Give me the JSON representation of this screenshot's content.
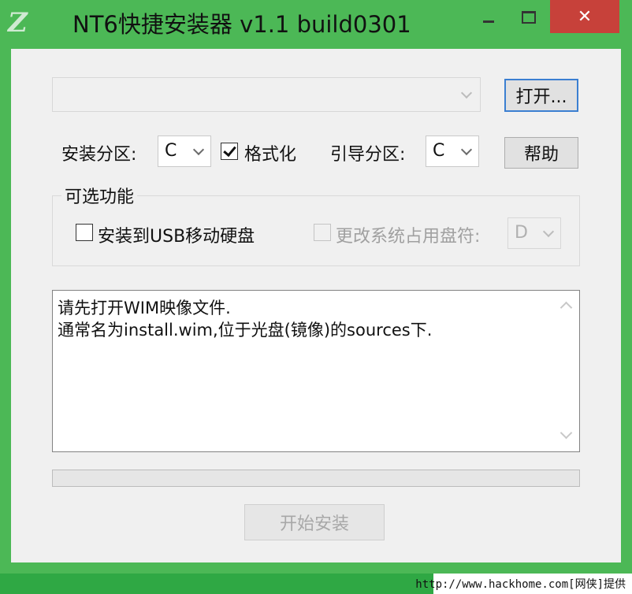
{
  "window": {
    "title": "NT6快捷安装器 v1.1 build0301",
    "close_label": "✕"
  },
  "wim_path": {
    "value": ""
  },
  "buttons": {
    "open": "打开...",
    "help": "帮助",
    "start_install": "开始安装"
  },
  "install_partition": {
    "label": "安装分区:",
    "value": "C"
  },
  "format": {
    "label": "格式化",
    "checked": true
  },
  "boot_partition": {
    "label": "引导分区:",
    "value": "C"
  },
  "optional_group": {
    "legend": "可选功能",
    "usb_install_label": "安装到USB移动硬盘",
    "usb_install_checked": false,
    "change_letter_label": "更改系统占用盘符:",
    "change_letter_checked": false,
    "change_letter_value": "D"
  },
  "message_log": {
    "lines": [
      "请先打开WIM映像文件.",
      "通常名为install.wim,位于光盘(镜像)的sources下."
    ]
  },
  "progress": {
    "percent": 0
  },
  "footer": {
    "credit": "http://www.hackhome.com[网侠]提供"
  },
  "colors": {
    "frame": "#4cb856",
    "close_button": "#c7413a",
    "client": "#f0f0f0"
  }
}
